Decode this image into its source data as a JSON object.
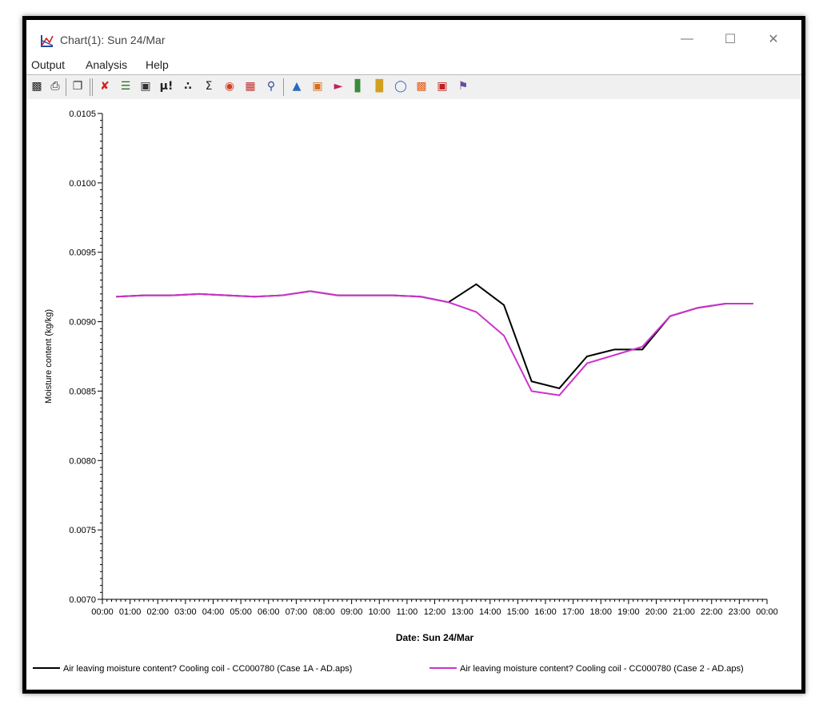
{
  "window": {
    "title": "Chart(1): Sun 24/Mar",
    "controls": {
      "minimize": "—",
      "maximize": "☐",
      "close": "✕"
    }
  },
  "menu": [
    "Output",
    "Analysis",
    "Help"
  ],
  "toolbar": {
    "icons": [
      "save-icon",
      "print-icon",
      "copy-icon",
      "line-chart-icon",
      "legend-icon",
      "camera-icon",
      "stats-mu-icon",
      "stats-icon",
      "sum-icon",
      "gauge-icon",
      "table-icon",
      "zoom-chart-icon",
      "area-chart-icon",
      "stacked-area-icon",
      "range-chart-icon",
      "bar-chart-icon",
      "column-chart-icon",
      "donut-chart-icon",
      "heatmap-icon",
      "contour-icon",
      "scan-icon"
    ]
  },
  "chart_data": {
    "type": "line",
    "xlabel": "Date: Sun 24/Mar",
    "ylabel": "Moisture content (kg/kg)",
    "ylim": [
      0.007,
      0.0105
    ],
    "yticks": [
      "0.0070",
      "0.0075",
      "0.0080",
      "0.0085",
      "0.0090",
      "0.0095",
      "0.0100",
      "0.0105"
    ],
    "xticks": [
      "00:00",
      "01:00",
      "02:00",
      "03:00",
      "04:00",
      "05:00",
      "06:00",
      "07:00",
      "08:00",
      "09:00",
      "10:00",
      "11:00",
      "12:00",
      "13:00",
      "14:00",
      "15:00",
      "16:00",
      "17:00",
      "18:00",
      "19:00",
      "20:00",
      "21:00",
      "22:00",
      "23:00",
      "00:00"
    ],
    "series": [
      {
        "name": "Air leaving moisture content? Cooling coil - CC000780 (Case 1A - AD.aps)",
        "color": "#000000",
        "x": [
          0.5,
          1.5,
          2.5,
          3.5,
          4.5,
          5.5,
          6.5,
          7.5,
          8.5,
          9.5,
          10.5,
          11.5,
          12.5,
          13.5,
          14.5,
          15.5,
          16.5,
          17.5,
          18.5,
          19.5,
          20.5,
          21.5,
          22.5,
          23.5
        ],
        "values": [
          0.00918,
          0.00919,
          0.00919,
          0.0092,
          0.00919,
          0.00918,
          0.00919,
          0.00922,
          0.00919,
          0.00919,
          0.00919,
          0.00918,
          0.00914,
          0.00927,
          0.00912,
          0.00857,
          0.00852,
          0.00875,
          0.0088,
          0.0088,
          0.00904,
          0.0091,
          0.00913,
          0.00913
        ]
      },
      {
        "name": "Air leaving moisture content? Cooling coil - CC000780 (Case 2 - AD.aps)",
        "color": "#cc33cc",
        "x": [
          0.5,
          1.5,
          2.5,
          3.5,
          4.5,
          5.5,
          6.5,
          7.5,
          8.5,
          9.5,
          10.5,
          11.5,
          12.5,
          13.5,
          14.5,
          15.5,
          16.5,
          17.5,
          18.5,
          19.5,
          20.5,
          21.5,
          22.5,
          23.5
        ],
        "values": [
          0.00918,
          0.00919,
          0.00919,
          0.0092,
          0.00919,
          0.00918,
          0.00919,
          0.00922,
          0.00919,
          0.00919,
          0.00919,
          0.00918,
          0.00914,
          0.00907,
          0.0089,
          0.0085,
          0.00847,
          0.0087,
          0.00876,
          0.00882,
          0.00904,
          0.0091,
          0.00913,
          0.00913
        ]
      }
    ]
  }
}
